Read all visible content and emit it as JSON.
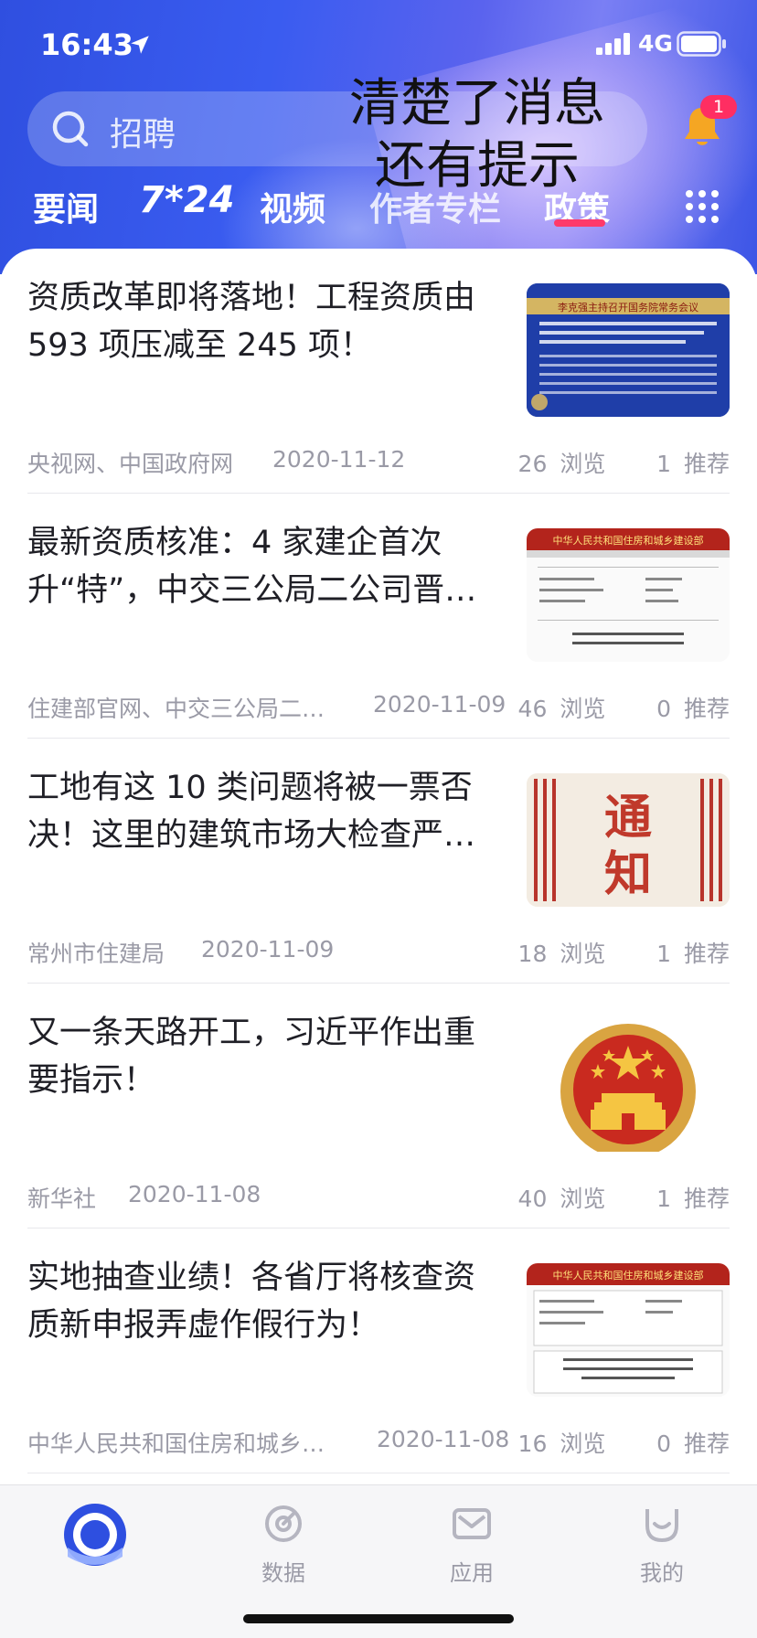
{
  "status_bar": {
    "time": "16:43",
    "network": "4G"
  },
  "search": {
    "placeholder": "招聘"
  },
  "notification": {
    "badge_count": "1"
  },
  "overlay_annotation": "清楚了消息还有提示",
  "tabs": [
    {
      "label": "要闻"
    },
    {
      "label": "7*24"
    },
    {
      "label": "视频"
    },
    {
      "label": "作者专栏"
    },
    {
      "label": "政策"
    }
  ],
  "articles": [
    {
      "title": "资质改革即将落地！工程资质由 593 项压减至 245 项！",
      "source": "央视网、中国政府网",
      "date": "2020-11-12",
      "views": "26",
      "views_label": "浏览",
      "recommends": "1",
      "recommends_label": "推荐",
      "thumb_caption": "李克强主持召开国务院常务会议"
    },
    {
      "title": "最新资质核准：4 家建企首次升“特”，中交三公局二公司晋…",
      "source": "住建部官网、中交三公局二…",
      "date": "2020-11-09",
      "views": "46",
      "views_label": "浏览",
      "recommends": "0",
      "recommends_label": "推荐",
      "thumb_caption": "中华人民共和国住房和城乡建设部"
    },
    {
      "title": "工地有这 10 类问题将被一票否决！这里的建筑市场大检查严…",
      "source": "常州市住建局",
      "date": "2020-11-09",
      "views": "18",
      "views_label": "浏览",
      "recommends": "1",
      "recommends_label": "推荐",
      "thumb_caption": "通知"
    },
    {
      "title": "又一条天路开工，习近平作出重要指示！",
      "source": "新华社",
      "date": "2020-11-08",
      "views": "40",
      "views_label": "浏览",
      "recommends": "1",
      "recommends_label": "推荐",
      "thumb_caption": ""
    },
    {
      "title": "实地抽查业绩！各省厅将核查资质新申报弄虚作假行为！",
      "source": "中华人民共和国住房和城乡…",
      "date": "2020-11-08",
      "views": "16",
      "views_label": "浏览",
      "recommends": "0",
      "recommends_label": "推荐",
      "thumb_caption": "中华人民共和国住房和城乡建设部"
    }
  ],
  "bottom_nav": [
    {
      "label": ""
    },
    {
      "label": "数据"
    },
    {
      "label": "应用"
    },
    {
      "label": "我的"
    }
  ],
  "colors": {
    "brand_blue": "#3a5cf0",
    "badge_pink": "#ff2e62",
    "tab_underline": "#ff3a6a",
    "meta_gray": "#9a9aa6"
  }
}
